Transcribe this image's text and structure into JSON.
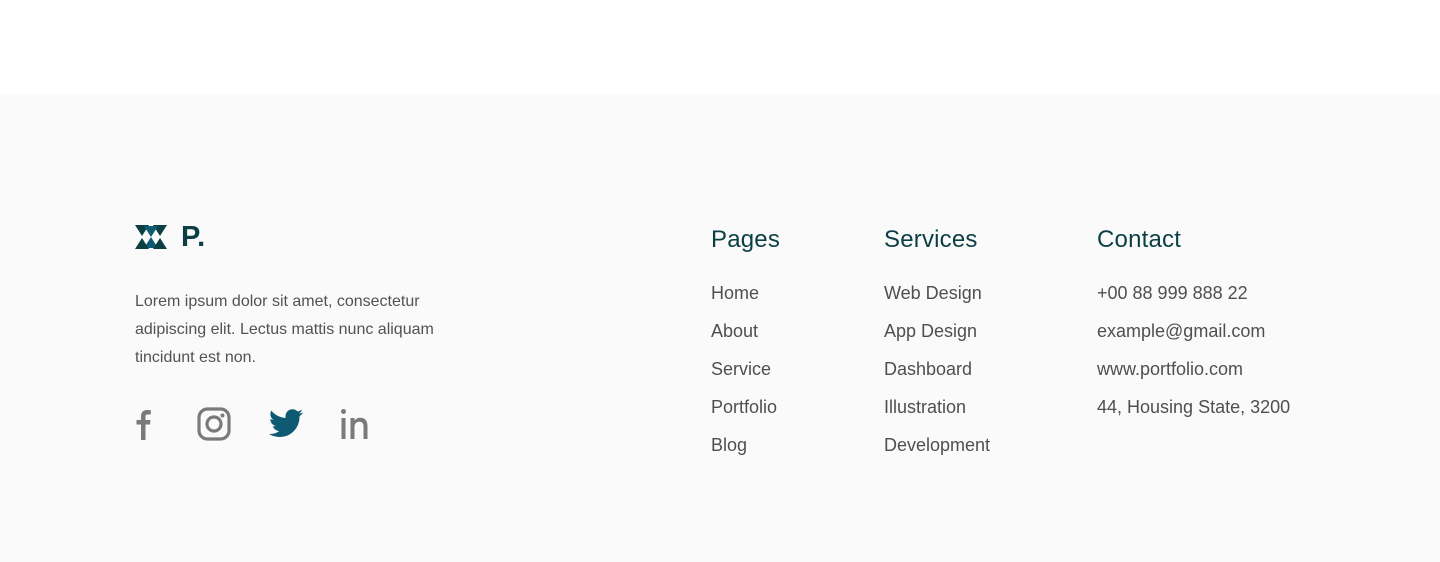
{
  "brand": {
    "logo_icon": "triangle-mark-icon",
    "logo_text": "P.",
    "about": "Lorem ipsum dolor sit amet, consectetur adipiscing elit. Lectus mattis nunc aliquam tincidunt est non.",
    "colors": {
      "primary": "#0b3f44",
      "accent": "#0d5a72",
      "muted": "#7a7a7a"
    }
  },
  "socials": [
    {
      "name": "facebook",
      "icon": "facebook-icon"
    },
    {
      "name": "instagram",
      "icon": "instagram-icon"
    },
    {
      "name": "twitter",
      "icon": "twitter-icon",
      "active": true
    },
    {
      "name": "linkedin",
      "icon": "linkedin-icon"
    }
  ],
  "pages": {
    "title": "Pages",
    "items": [
      "Home",
      "About",
      "Service",
      "Portfolio",
      "Blog"
    ]
  },
  "services": {
    "title": "Services",
    "items": [
      "Web Design",
      "App Design",
      "Dashboard",
      "Illustration",
      "Development"
    ]
  },
  "contact": {
    "title": "Contact",
    "items": [
      "+00 88 999 888 22",
      "example@gmail.com",
      "www.portfolio.com",
      "44, Housing State, 3200"
    ]
  }
}
